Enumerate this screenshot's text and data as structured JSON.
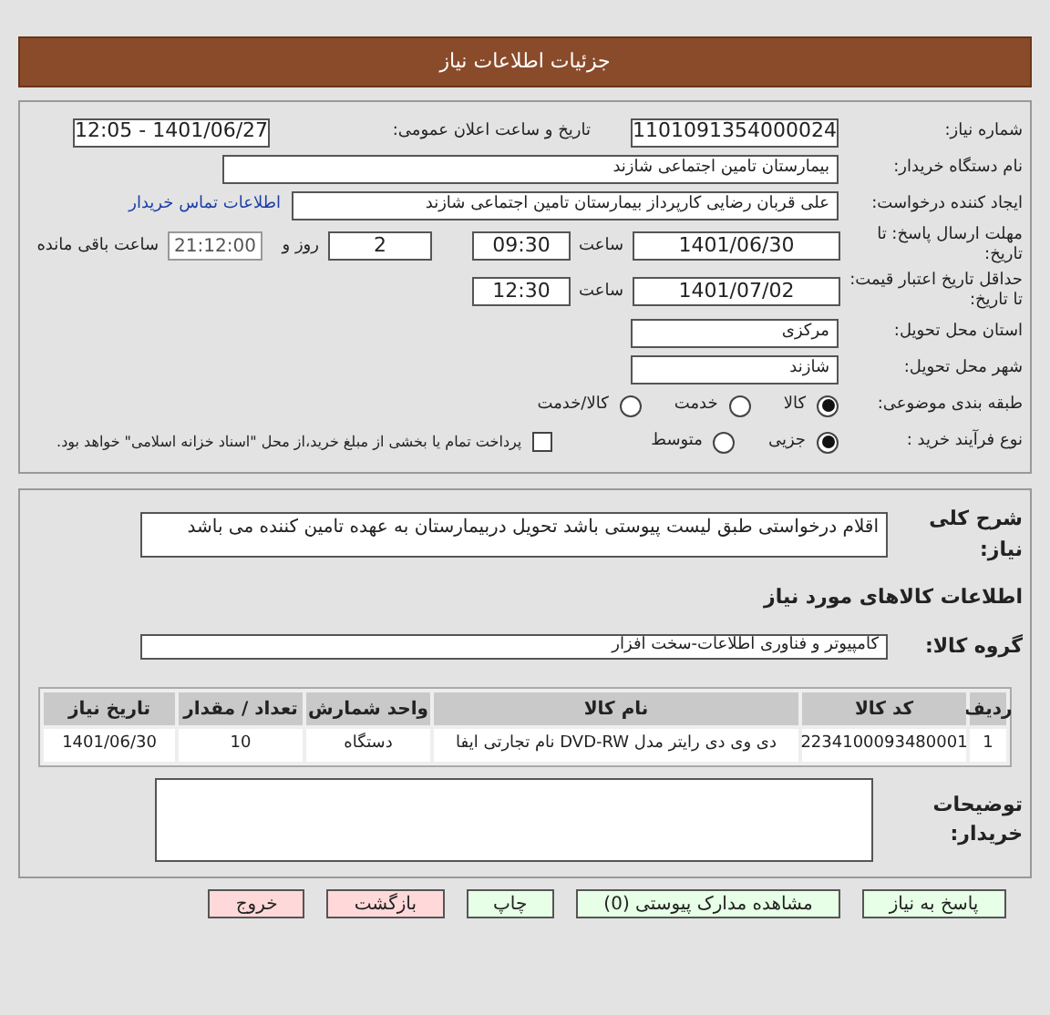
{
  "header": {
    "title": "جزئیات اطلاعات نیاز"
  },
  "need_number": {
    "label": "شماره نیاز:",
    "value": "1101091354000024"
  },
  "announce": {
    "label": "تاریخ و ساعت اعلان عمومی:",
    "value": "1401/06/27 - 12:05"
  },
  "buyer_org": {
    "label": "نام دستگاه خریدار:",
    "value": "بیمارستان تامین اجتماعی شازند"
  },
  "creator": {
    "label": "ایجاد کننده درخواست:",
    "value": "علی قربان  رضایی کارپرداز بیمارستان تامین اجتماعی شازند",
    "link": "اطلاعات تماس خریدار"
  },
  "deadline": {
    "label": "مهلت ارسال پاسخ: تا تاریخ:",
    "date": "1401/06/30",
    "time_label": "ساعت",
    "time": "09:30",
    "days": "2",
    "days_label": "روز و",
    "remaining": "21:12:00",
    "remaining_label": "ساعت باقی مانده"
  },
  "validity": {
    "label": "حداقل تاریخ اعتبار قیمت: تا تاریخ:",
    "date": "1401/07/02",
    "time_label": "ساعت",
    "time": "12:30"
  },
  "province": {
    "label": "استان محل تحویل:",
    "value": "مرکزی"
  },
  "city": {
    "label": "شهر محل تحویل:",
    "value": "شازند"
  },
  "category": {
    "label": "طبقه بندی موضوعی:",
    "options": [
      {
        "label": "کالا",
        "selected": true
      },
      {
        "label": "خدمت",
        "selected": false
      },
      {
        "label": "کالا/خدمت",
        "selected": false
      }
    ]
  },
  "process": {
    "label": "نوع فرآیند خرید :",
    "options": [
      {
        "label": "جزیی",
        "selected": true
      },
      {
        "label": "متوسط",
        "selected": false
      }
    ],
    "payment": {
      "label": "پرداخت تمام یا بخشی از مبلغ خرید،از محل \"اسناد خزانه اسلامی\" خواهد بود.",
      "checked": false
    }
  },
  "description": {
    "label": "شرح کلی نیاز:",
    "value": "اقلام درخواستی طبق لیست پیوستی باشد تحویل دربیمارستان به عهده تامین کننده می باشد"
  },
  "goods_title": "اطلاعات کالاهای مورد نیاز",
  "goods_group": {
    "label": "گروه کالا:",
    "value": "کامپیوتر و فناوری اطلاعات-سخت افزار"
  },
  "table": {
    "columns": [
      "ردیف",
      "کد کالا",
      "نام کالا",
      "واحد شمارش",
      "تعداد / مقدار",
      "تاریخ نیاز"
    ],
    "rows": [
      [
        "1",
        "2234100093480001",
        "دی وی دی رایتر مدل DVD-RW نام تجارتی ایفا",
        "دستگاه",
        "10",
        "1401/06/30"
      ]
    ]
  },
  "buyer_notes": {
    "label": "توضیحات خریدار:"
  },
  "buttons": [
    {
      "label": "پاسخ به نیاز",
      "kind": "primary"
    },
    {
      "label": "مشاهده مدارک پیوستی (0)",
      "kind": "primary"
    },
    {
      "label": "چاپ",
      "kind": "primary"
    },
    {
      "label": "بازگشت",
      "kind": "danger"
    },
    {
      "label": "خروج",
      "kind": "danger"
    }
  ]
}
